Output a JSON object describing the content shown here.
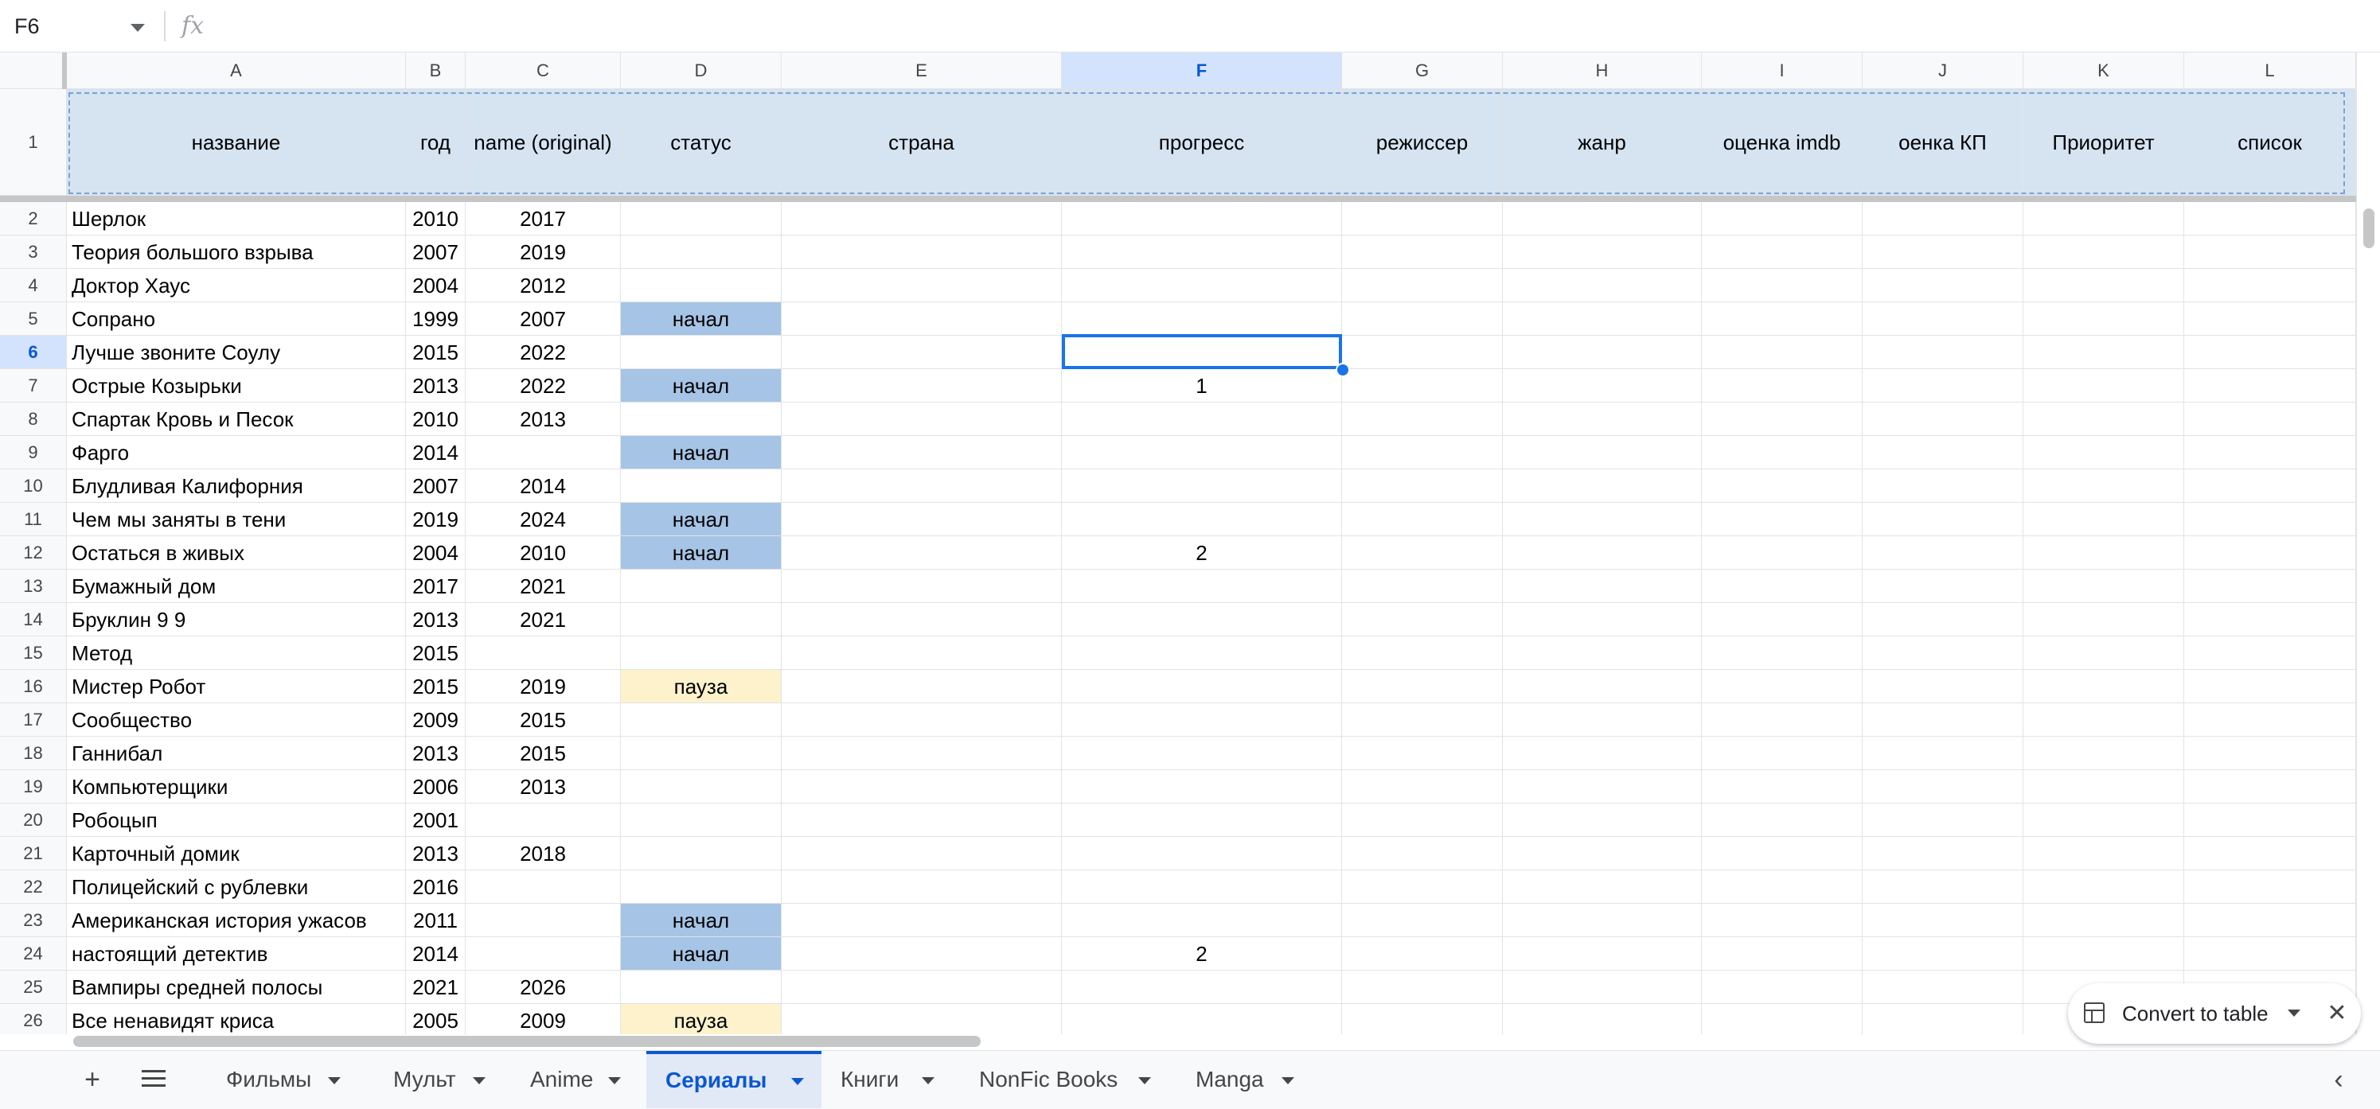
{
  "formula_bar": {
    "cell_ref": "F6",
    "fx_label": "fx",
    "formula": ""
  },
  "columns": [
    "A",
    "B",
    "C",
    "D",
    "E",
    "F",
    "G",
    "H",
    "I",
    "J",
    "K",
    "L"
  ],
  "selected_column": "F",
  "selected_row": "6",
  "headers": [
    "название",
    "год",
    "name (original)",
    "статус",
    "страна",
    "прогресс",
    "режиссер",
    "жанр",
    "оценка imdb",
    "оенка КП",
    "Приоритет",
    "список"
  ],
  "rows": [
    {
      "n": "2",
      "title": "Шерлок",
      "year": "2010",
      "orig": "2017",
      "status": "",
      "progress": ""
    },
    {
      "n": "3",
      "title": "Теория большого взрыва",
      "year": "2007",
      "orig": "2019",
      "status": "",
      "progress": ""
    },
    {
      "n": "4",
      "title": "Доктор Хаус",
      "year": "2004",
      "orig": "2012",
      "status": "",
      "progress": ""
    },
    {
      "n": "5",
      "title": "Сопрано",
      "year": "1999",
      "orig": "2007",
      "status": "начал",
      "progress": ""
    },
    {
      "n": "6",
      "title": "Лучше звоните Соулу",
      "year": "2015",
      "orig": "2022",
      "status": "",
      "progress": ""
    },
    {
      "n": "7",
      "title": "Острые Козырьки",
      "year": "2013",
      "orig": "2022",
      "status": "начал",
      "progress": "1"
    },
    {
      "n": "8",
      "title": "Спартак Кровь и Песок",
      "year": "2010",
      "orig": "2013",
      "status": "",
      "progress": ""
    },
    {
      "n": "9",
      "title": "Фарго",
      "year": "2014",
      "orig": "",
      "status": "начал",
      "progress": ""
    },
    {
      "n": "10",
      "title": "Блудливая Калифорния",
      "year": "2007",
      "orig": "2014",
      "status": "",
      "progress": ""
    },
    {
      "n": "11",
      "title": "Чем мы заняты в тени",
      "year": "2019",
      "orig": "2024",
      "status": "начал",
      "progress": ""
    },
    {
      "n": "12",
      "title": "Остаться в живых",
      "year": "2004",
      "orig": "2010",
      "status": "начал",
      "progress": "2"
    },
    {
      "n": "13",
      "title": "Бумажный дом",
      "year": "2017",
      "orig": "2021",
      "status": "",
      "progress": ""
    },
    {
      "n": "14",
      "title": "Бруклин 9 9",
      "year": "2013",
      "orig": "2021",
      "status": "",
      "progress": ""
    },
    {
      "n": "15",
      "title": "Метод",
      "year": "2015",
      "orig": "",
      "status": "",
      "progress": ""
    },
    {
      "n": "16",
      "title": "Мистер Робот",
      "year": "2015",
      "orig": "2019",
      "status": "пауза",
      "progress": ""
    },
    {
      "n": "17",
      "title": "Сообщество",
      "year": "2009",
      "orig": "2015",
      "status": "",
      "progress": ""
    },
    {
      "n": "18",
      "title": "Ганнибал",
      "year": "2013",
      "orig": "2015",
      "status": "",
      "progress": ""
    },
    {
      "n": "19",
      "title": "Компьютерщики",
      "year": "2006",
      "orig": "2013",
      "status": "",
      "progress": ""
    },
    {
      "n": "20",
      "title": "Робоцып",
      "year": "2001",
      "orig": "",
      "status": "",
      "progress": ""
    },
    {
      "n": "21",
      "title": "Карточный домик",
      "year": "2013",
      "orig": "2018",
      "status": "",
      "progress": ""
    },
    {
      "n": "22",
      "title": "Полицейский с рублевки",
      "year": "2016",
      "orig": "",
      "status": "",
      "progress": ""
    },
    {
      "n": "23",
      "title": "Американская история ужасов",
      "year": "2011",
      "orig": "",
      "status": "начал",
      "progress": ""
    },
    {
      "n": "24",
      "title": "настоящий детектив",
      "year": "2014",
      "orig": "",
      "status": "начал",
      "progress": "2"
    },
    {
      "n": "25",
      "title": "Вампиры средней полосы",
      "year": "2021",
      "orig": "2026",
      "status": "",
      "progress": ""
    },
    {
      "n": "26",
      "title": "Все ненавидят криса",
      "year": "2005",
      "orig": "2009",
      "status": "пауза",
      "progress": ""
    }
  ],
  "status_colors": {
    "начал": "#a6c4e5",
    "пауза": "#fdf2cc"
  },
  "convert_chip": {
    "label": "Convert to table",
    "icon": "table-icon",
    "close": "✕"
  },
  "tab_bar": {
    "add_icon": "+",
    "sheets": [
      "Фильмы",
      "Мульт",
      "Anime",
      "Сериалы",
      "Книги",
      "NonFic Books",
      "Manga"
    ],
    "active": "Сериалы",
    "back_icon": "‹"
  }
}
